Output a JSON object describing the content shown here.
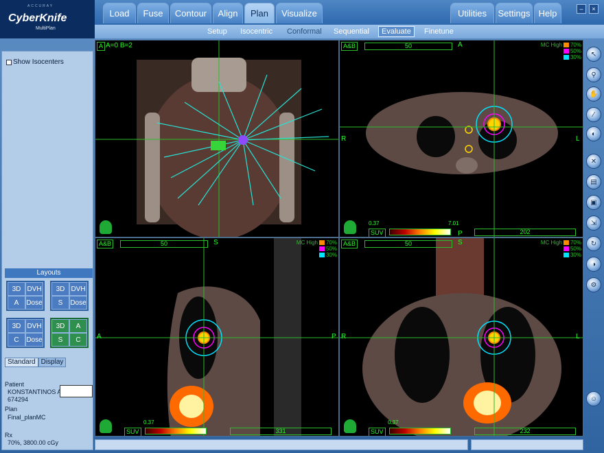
{
  "header": {
    "company": "ACCURAY",
    "brand": "CyberKnife",
    "product": "MultiPlan"
  },
  "main_tabs": [
    "Load",
    "Fuse",
    "Contour",
    "Align",
    "Plan",
    "Visualize"
  ],
  "right_tabs": [
    "Utilities",
    "Settings",
    "Help"
  ],
  "window_controls": {
    "minimize": "–",
    "close": "×"
  },
  "sub_tabs": [
    "Setup",
    "Isocentric",
    "Conformal",
    "Sequential",
    "Evaluate",
    "Finetune"
  ],
  "left_panel": {
    "show_isocenters_label": "Show Isocenters",
    "layouts_title": "Layouts",
    "layouts": [
      [
        "3D",
        "DVH",
        "A",
        "Dose"
      ],
      [
        "3D",
        "DVH",
        "S",
        "Dose"
      ],
      [
        "3D",
        "DVH",
        "C",
        "Dose"
      ],
      [
        "3D",
        "A",
        "S",
        "C"
      ]
    ],
    "tabs": [
      "Standard",
      "Display"
    ],
    "patient_label": "Patient",
    "patient_name": "KONSTANTINOS A",
    "patient_id": "674294",
    "plan_label": "Plan",
    "plan_name": "Final_planMC",
    "rx_label": "Rx",
    "rx_value": "70%, 3800.00 cGy"
  },
  "viewports": {
    "top_left": {
      "tag": "A",
      "caption": "A=0 B=2"
    },
    "top_right": {
      "tag": "A&B",
      "slider_value": "50",
      "orient_top": "A",
      "orient_left": "R",
      "orient_right": "L",
      "orient_bottom": "P",
      "algorithm": "MC High",
      "suv_label": "SUV",
      "suv_min": "0.37",
      "suv_max": "7.01",
      "slice": "202"
    },
    "bottom_left": {
      "tag": "A&B",
      "slider_value": "50",
      "orient_top": "S",
      "orient_left": "A",
      "orient_right": "P",
      "algorithm": "MC High",
      "suv_label": "SUV",
      "suv_min": "0.37",
      "suv_max": "7.01",
      "slice": "331"
    },
    "bottom_right": {
      "tag": "A&B",
      "slider_value": "50",
      "orient_top": "S",
      "orient_left": "R",
      "orient_right": "L",
      "algorithm": "MC High",
      "suv_label": "SUV",
      "suv_min": "0.37",
      "suv_max": "7.01",
      "slice": "232"
    }
  },
  "isodose_legend": [
    {
      "label": "70%",
      "color": "#ff8c00"
    },
    {
      "label": "50%",
      "color": "#ff00ff"
    },
    {
      "label": "30%",
      "color": "#00e5ff"
    }
  ],
  "toolbar_icons": [
    "pointer-icon",
    "zoom-icon",
    "pan-icon",
    "measure-icon",
    "window-level-icon",
    "crosshair-icon",
    "print-icon",
    "camera-icon",
    "export-icon",
    "rotate-icon",
    "contrast-icon",
    "tools-icon",
    "user-icon"
  ]
}
